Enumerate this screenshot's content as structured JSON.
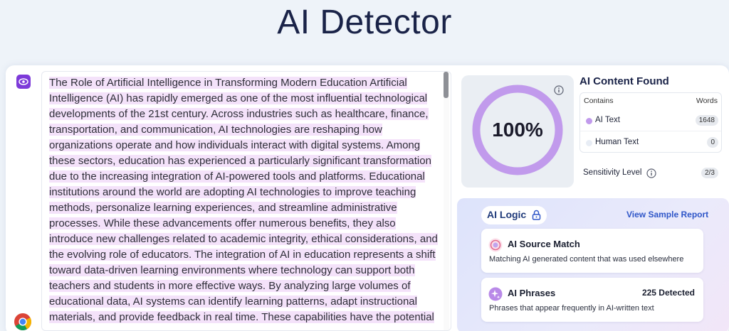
{
  "page": {
    "title": "AI Detector"
  },
  "editor": {
    "text": "The Role of Artificial Intelligence in Transforming Modern Education Artificial Intelligence (AI) has rapidly emerged as one of the most influential technological developments of the 21st century. Across industries such as healthcare, finance, transportation, and communication, AI technologies are reshaping how organizations operate and how individuals interact with digital systems. Among these sectors, education has experienced a particularly significant transformation due to the increasing integration of AI-powered tools and platforms. Educational institutions around the world are adopting AI technologies to improve teaching methods, personalize learning experiences, and streamline administrative processes. While these advancements offer numerous benefits, they also introduce new challenges related to academic integrity, ethical considerations, and the evolving role of educators. The integration of AI in education represents a shift toward data-driven learning environments where technology can support both teachers and students in more effective ways. By analyzing large volumes of educational data, AI systems can identify learning patterns, adapt instructional materials, and provide feedback in real time. These capabilities have the potential",
    "highlight_color": "#f4e2fa"
  },
  "icons": {
    "view": "eye-icon",
    "browser": "chrome-icon"
  },
  "score": {
    "value": "100%",
    "percent": 100,
    "ring_color": "#c19aec"
  },
  "results": {
    "title": "AI Content Found",
    "table": {
      "col_contains": "Contains",
      "col_words": "Words",
      "rows": [
        {
          "label": "AI Text",
          "words": "1648",
          "dot_color": "#c19aec"
        },
        {
          "label": "Human Text",
          "words": "0",
          "dot_color": "#e8edf5"
        }
      ]
    },
    "sensitivity": {
      "label": "Sensitivity Level",
      "value": "2/3"
    }
  },
  "logic": {
    "label": "AI Logic",
    "link": "View Sample Report",
    "cards": [
      {
        "title": "AI Source Match",
        "description": "Matching AI generated content that was used elsewhere",
        "count": ""
      },
      {
        "title": "AI Phrases",
        "description": "Phrases that appear frequently in AI-written text",
        "count": "225 Detected"
      }
    ]
  },
  "colors": {
    "accent": "#7d3ad9",
    "link": "#2f56c8",
    "title": "#1a2348"
  }
}
